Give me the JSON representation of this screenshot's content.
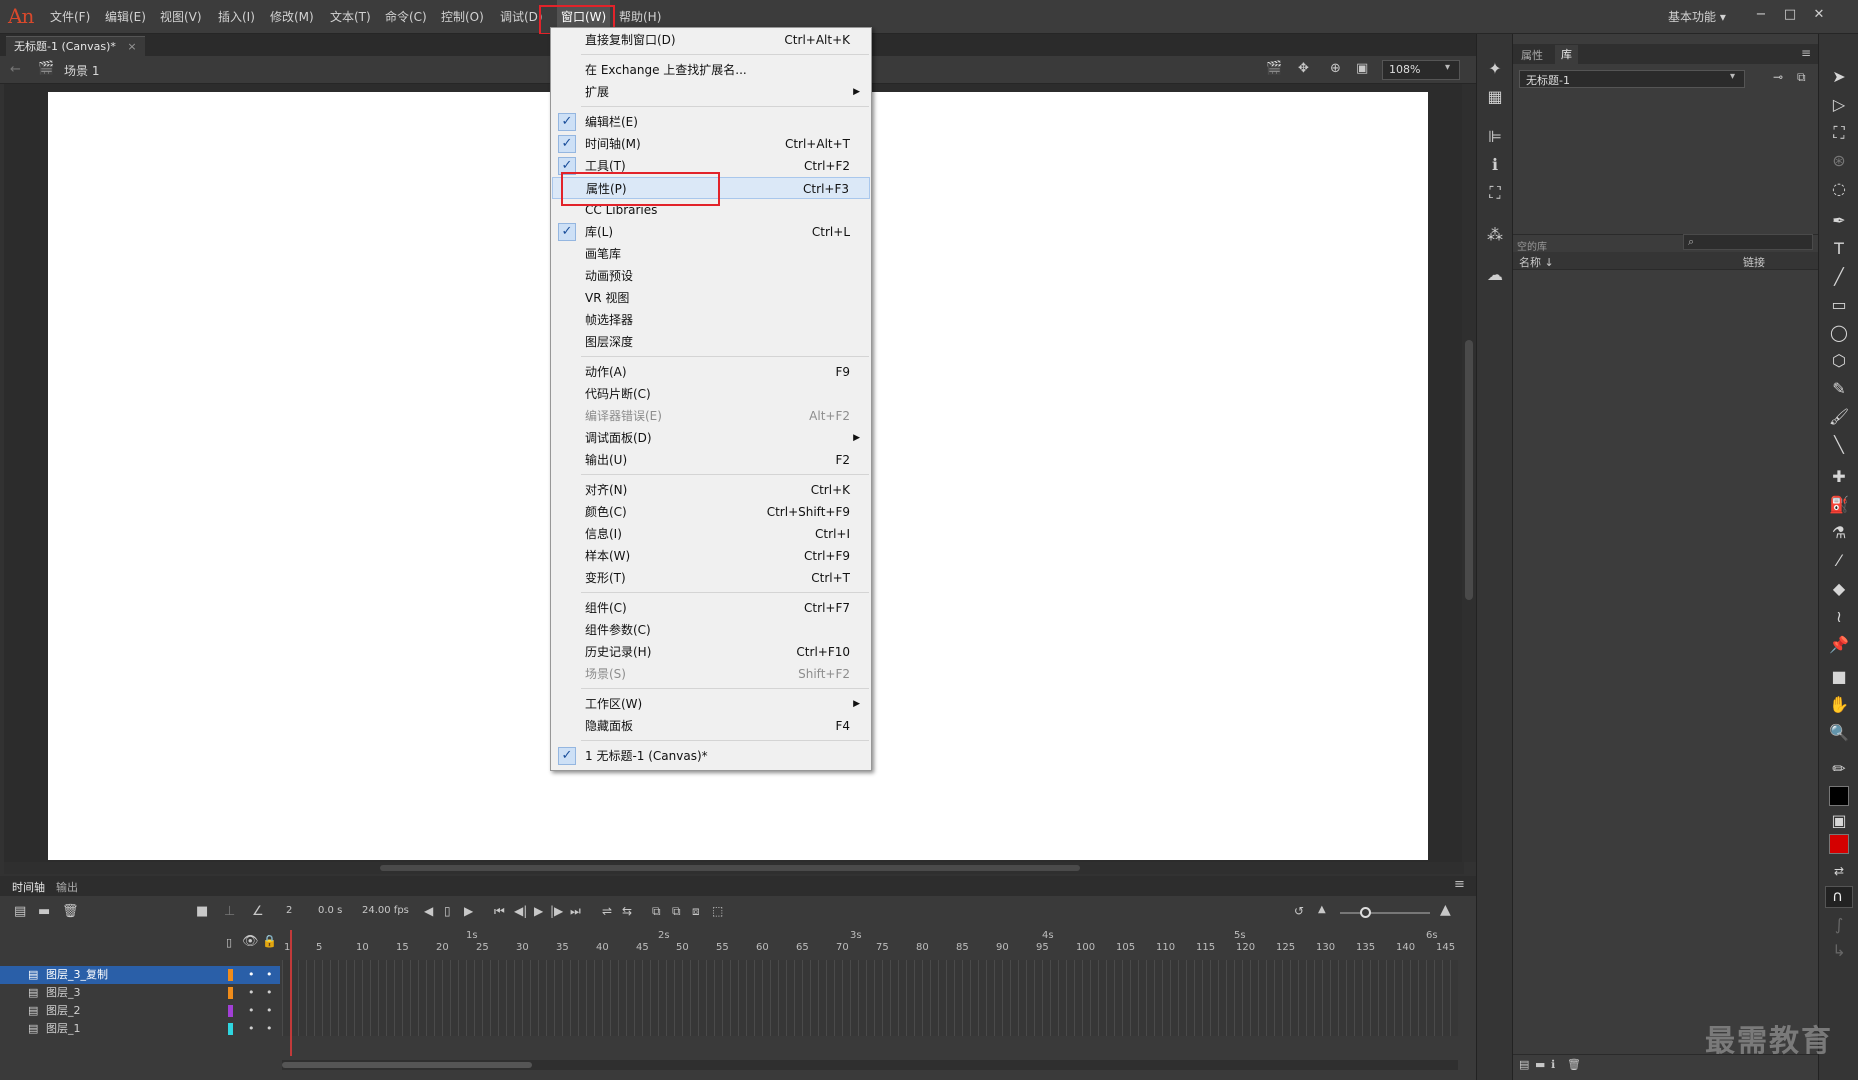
{
  "app": {
    "logo": "An"
  },
  "menubar": {
    "items": [
      {
        "label": "文件(F)"
      },
      {
        "label": "编辑(E)"
      },
      {
        "label": "视图(V)"
      },
      {
        "label": "插入(I)"
      },
      {
        "label": "修改(M)"
      },
      {
        "label": "文本(T)"
      },
      {
        "label": "命令(C)"
      },
      {
        "label": "控制(O)"
      },
      {
        "label": "调试(D)"
      },
      {
        "label": "窗口(W)"
      },
      {
        "label": "帮助(H)"
      }
    ],
    "workspace": "基本功能",
    "win_controls": [
      "−",
      "□",
      "✕"
    ]
  },
  "document": {
    "tab_label": "无标题-1 (Canvas)*",
    "tab_close": "×"
  },
  "editbar": {
    "scene_label": "场景 1",
    "zoom": "108%"
  },
  "window_menu": {
    "items": [
      {
        "label": "直接复制窗口(D)",
        "shortcut": "Ctrl+Alt+K",
        "checked": false,
        "disabled": false
      },
      {
        "sep": true
      },
      {
        "label": "在 Exchange 上查找扩展名...",
        "shortcut": "",
        "checked": false,
        "disabled": false
      },
      {
        "label": "扩展",
        "shortcut": "",
        "submenu": true
      },
      {
        "sep": true
      },
      {
        "label": "编辑栏(E)",
        "shortcut": "",
        "checked": true
      },
      {
        "label": "时间轴(M)",
        "shortcut": "Ctrl+Alt+T",
        "checked": true
      },
      {
        "label": "工具(T)",
        "shortcut": "Ctrl+F2",
        "checked": true
      },
      {
        "label": "属性(P)",
        "shortcut": "Ctrl+F3",
        "checked": false,
        "highlight": true
      },
      {
        "label": "CC Libraries",
        "shortcut": ""
      },
      {
        "label": "库(L)",
        "shortcut": "Ctrl+L",
        "checked": true
      },
      {
        "label": "画笔库",
        "shortcut": ""
      },
      {
        "label": "动画预设",
        "shortcut": ""
      },
      {
        "label": "VR 视图",
        "shortcut": ""
      },
      {
        "label": "帧选择器",
        "shortcut": ""
      },
      {
        "label": "图层深度",
        "shortcut": ""
      },
      {
        "sep": true
      },
      {
        "label": "动作(A)",
        "shortcut": "F9"
      },
      {
        "label": "代码片断(C)",
        "shortcut": ""
      },
      {
        "label": "编译器错误(E)",
        "shortcut": "Alt+F2",
        "disabled": true
      },
      {
        "label": "调试面板(D)",
        "shortcut": "",
        "submenu": true
      },
      {
        "label": "输出(U)",
        "shortcut": "F2"
      },
      {
        "sep": true
      },
      {
        "label": "对齐(N)",
        "shortcut": "Ctrl+K"
      },
      {
        "label": "颜色(C)",
        "shortcut": "Ctrl+Shift+F9"
      },
      {
        "label": "信息(I)",
        "shortcut": "Ctrl+I"
      },
      {
        "label": "样本(W)",
        "shortcut": "Ctrl+F9"
      },
      {
        "label": "变形(T)",
        "shortcut": "Ctrl+T"
      },
      {
        "sep": true
      },
      {
        "label": "组件(C)",
        "shortcut": "Ctrl+F7"
      },
      {
        "label": "组件参数(C)",
        "shortcut": ""
      },
      {
        "label": "历史记录(H)",
        "shortcut": "Ctrl+F10"
      },
      {
        "label": "场景(S)",
        "shortcut": "Shift+F2",
        "disabled": true
      },
      {
        "sep": true
      },
      {
        "label": "工作区(W)",
        "shortcut": "",
        "submenu": true
      },
      {
        "label": "隐藏面板",
        "shortcut": "F4"
      },
      {
        "sep": true
      },
      {
        "label": "1 无标题-1 (Canvas)*",
        "shortcut": "",
        "checked": true
      }
    ]
  },
  "timeline": {
    "tabs": [
      "时间轴",
      "输出"
    ],
    "current_frame": "2",
    "time": "0.0 s",
    "fps": "24.00 fps",
    "layers": [
      {
        "name": "图层_3_复制",
        "color": "#f08c1a",
        "selected": true
      },
      {
        "name": "图层_3",
        "color": "#f08c1a",
        "selected": false
      },
      {
        "name": "图层_2",
        "color": "#a23fd6",
        "selected": false
      },
      {
        "name": "图层_1",
        "color": "#2fd6e0",
        "selected": false
      }
    ],
    "ruler_frames": [
      "1",
      "5",
      "10",
      "15",
      "20",
      "25",
      "30",
      "35",
      "40",
      "45",
      "50",
      "55",
      "60",
      "65",
      "70",
      "75",
      "80",
      "85",
      "90",
      "95",
      "100",
      "105",
      "110",
      "115",
      "120",
      "125",
      "130",
      "135",
      "140",
      "145"
    ],
    "ruler_seconds": [
      "1s",
      "2s",
      "3s",
      "4s",
      "5s",
      "6s"
    ]
  },
  "panels": {
    "tabs": [
      "属性",
      "库"
    ],
    "library_doc": "无标题-1",
    "empty_label": "空的库",
    "col_name": "名称 ↓",
    "col_link": "链接"
  },
  "watermark": "最需教育"
}
